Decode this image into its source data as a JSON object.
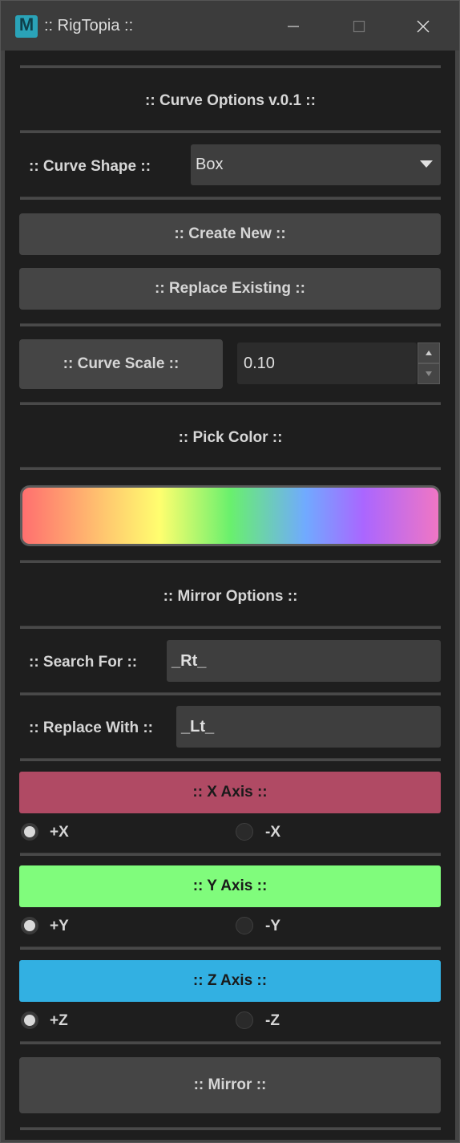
{
  "window": {
    "title": ":: RigTopia ::",
    "app_icon_letter": "M"
  },
  "header": {
    "title": ":: Curve Options v.0.1 ::"
  },
  "curve_shape": {
    "label": ":: Curve Shape ::",
    "selected": "Box"
  },
  "buttons": {
    "create_new": ":: Create New ::",
    "replace_existing": ":: Replace Existing ::",
    "curve_scale": ":: Curve Scale ::",
    "mirror": ":: Mirror ::"
  },
  "curve_scale": {
    "value": "0.10"
  },
  "color_section": {
    "title": ":: Pick Color ::"
  },
  "mirror_section": {
    "title": ":: Mirror Options ::",
    "search_label": ":: Search For ::",
    "search_value": "_Rt_",
    "replace_label": ":: Replace With ::",
    "replace_value": "_Lt_"
  },
  "axes": [
    {
      "label": ":: X Axis ::",
      "color": "#b04a64",
      "text_color": "#1a1a1a",
      "pos": "+X",
      "neg": "-X",
      "selected": "+X"
    },
    {
      "label": ":: Y Axis ::",
      "color": "#80fc7c",
      "text_color": "#1a1a1a",
      "pos": "+Y",
      "neg": "-Y",
      "selected": "+Y"
    },
    {
      "label": ":: Z Axis ::",
      "color": "#32b0e2",
      "text_color": "#1a1a1a",
      "pos": "+Z",
      "neg": "-Z",
      "selected": "+Z"
    }
  ]
}
